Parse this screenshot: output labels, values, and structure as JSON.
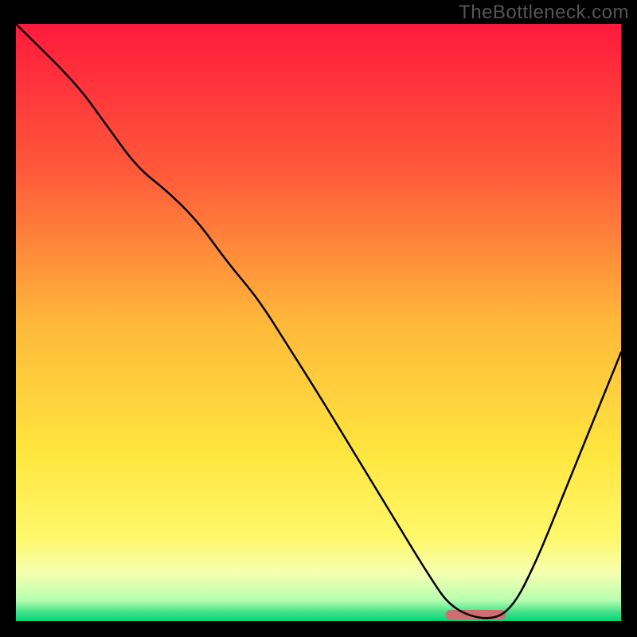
{
  "watermark": "TheBottleneck.com",
  "chart_data": {
    "type": "line",
    "title": "",
    "xlabel": "",
    "ylabel": "",
    "xlim": [
      0,
      100
    ],
    "ylim": [
      0,
      100
    ],
    "series": [
      {
        "name": "bottleneck-curve",
        "x": [
          0,
          10,
          15,
          20,
          25,
          30,
          35,
          40,
          45,
          50,
          56,
          62,
          68,
          72,
          78,
          82,
          86,
          90,
          94,
          100
        ],
        "values": [
          100,
          90,
          83,
          76,
          72,
          67,
          60,
          54,
          46,
          38,
          28,
          18,
          8,
          2,
          0,
          2,
          10,
          20,
          30,
          45
        ]
      }
    ],
    "optimum_marker": {
      "x": 76,
      "width": 10,
      "color": "#cf6e70"
    },
    "background_gradient": {
      "stops": [
        {
          "offset": 0.0,
          "color": "#ff1a3d"
        },
        {
          "offset": 0.25,
          "color": "#ff5a3a"
        },
        {
          "offset": 0.5,
          "color": "#ffb83a"
        },
        {
          "offset": 0.72,
          "color": "#ffe63f"
        },
        {
          "offset": 0.86,
          "color": "#fff86a"
        },
        {
          "offset": 0.92,
          "color": "#f6ffb0"
        },
        {
          "offset": 0.965,
          "color": "#b6ffb0"
        },
        {
          "offset": 0.985,
          "color": "#44e08a"
        },
        {
          "offset": 1.0,
          "color": "#00d67a"
        }
      ]
    }
  }
}
